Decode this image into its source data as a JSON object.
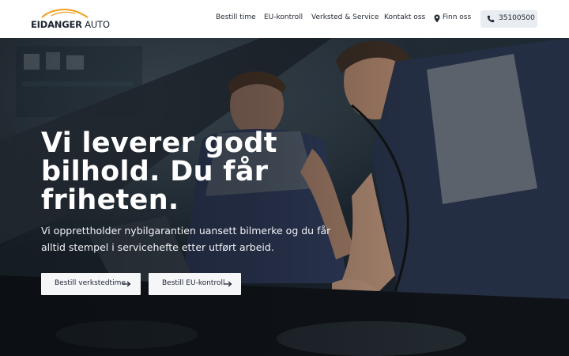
{
  "header": {
    "logo": {
      "brand_bold": "EIDANGER",
      "brand_light": "AUTO",
      "icon": "car-swoosh-logo",
      "accent": "#f0a020"
    },
    "nav": [
      {
        "label": "Bestill time"
      },
      {
        "label": "EU-kontroll"
      },
      {
        "label": "Verksted & Service"
      },
      {
        "label": "Kontakt oss"
      },
      {
        "label": "Finn oss",
        "icon": "map-pin-icon"
      }
    ],
    "phone": {
      "icon": "phone-icon",
      "number": "35100500"
    }
  },
  "hero": {
    "title": "Vi leverer godt bilhold. Du får friheten.",
    "subtitle": "Vi opprettholder nybilgarantien uansett bilmerke og du får alltid stempel i servicehefte etter utført arbeid.",
    "buttons": [
      {
        "label": "Bestill verkstedtime",
        "icon": "arrow-right-icon"
      },
      {
        "label": "Bestill EU-kontroll",
        "icon": "arrow-right-icon"
      }
    ]
  }
}
